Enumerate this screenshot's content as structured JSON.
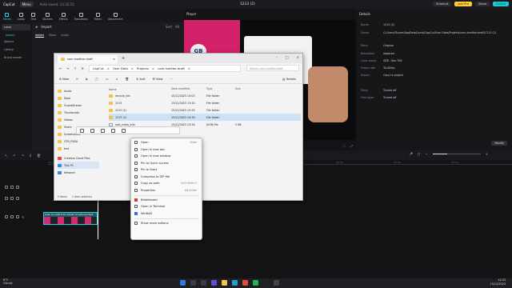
{
  "app": {
    "brand": "CapCut",
    "menu_label": "Menu",
    "autosave": "Auto saved: 13:32:53",
    "title": "1213 (2)",
    "shortcut_label": "Shortcut",
    "join_pro_label": "Join Pro",
    "share_label": "Share",
    "export_label": "Export"
  },
  "tools": [
    {
      "label": "Media",
      "active": true
    },
    {
      "label": "Audio"
    },
    {
      "label": "Text"
    },
    {
      "label": "Stickers"
    },
    {
      "label": "Effects"
    },
    {
      "label": "Transitions"
    },
    {
      "label": "Filters"
    },
    {
      "label": "Adjustment"
    }
  ],
  "left_sidebar": {
    "items": [
      "Local",
      "Import",
      "Spaces",
      "Library",
      "Brand assets"
    ]
  },
  "media": {
    "import_label": "Import",
    "sort_label": "Sort",
    "all_label": "All",
    "tabs": [
      "Added",
      "Video",
      "Audio"
    ]
  },
  "player": {
    "title": "Player",
    "logo_text": "GB"
  },
  "details": {
    "title": "Details",
    "rows": [
      {
        "k": "Name",
        "v": "1213 (2)"
      },
      {
        "k": "Saved",
        "v": "C:/Users/Tucker/AppData/Local/CapCut/User Data/Projects/com.lveditor.draft/1213 (2)"
      },
      {
        "k": "Ratio",
        "v": "Original"
      },
      {
        "k": "Resolution",
        "v": "Adapted"
      },
      {
        "k": "Color space",
        "v": "SDR - Rec.709"
      },
      {
        "k": "Frame rate",
        "v": "30.00fps"
      },
      {
        "k": "Import",
        "v": "Copy to project"
      },
      {
        "k": "Proxy",
        "v": "Turned off"
      },
      {
        "k": "Free layer",
        "v": "Turned off"
      }
    ],
    "modify_label": "Modify"
  },
  "timeline": {
    "ticks": [
      "00:00",
      "00:10",
      "00:20",
      "00:30",
      "00:40",
      "00:50",
      "01:00",
      "01:10"
    ],
    "clip_label": "scan qr code from photo on iphone.mp4"
  },
  "explorer": {
    "tab_title": "com.lveditor.draft",
    "crumbs": [
      "CapCut",
      ">",
      "User Data",
      ">",
      "Projects",
      ">",
      "com.lveditor.draft",
      ">"
    ],
    "search_placeholder": "Search com.lveditor.draft",
    "cmd": [
      "New",
      "Sort",
      "View",
      "Details"
    ],
    "nav": [
      "Audio",
      "Dipsi",
      "GuardStream",
      "Thumbnails",
      "Videos",
      "Share",
      "Screenshots",
      "GTR_FNSA",
      "test",
      "Creative Cloud Files",
      "This PC",
      "Network"
    ],
    "headers": {
      "name": "Name",
      "date": "Date modified",
      "type": "Type",
      "size": "Size"
    },
    "rows": [
      {
        "name": "recycle_bin",
        "date": "15/12/2023 13:03",
        "type": "File folder",
        "size": ""
      },
      {
        "name": "1213",
        "date": "15/12/2023 13:10",
        "type": "File folder",
        "size": ""
      },
      {
        "name": "1213 (1)",
        "date": "15/12/2023 13:29",
        "type": "File folder",
        "size": ""
      },
      {
        "name": "1213 (2)",
        "date": "15/12/2023 13:30",
        "type": "File folder",
        "size": ""
      },
      {
        "name": "root_meta_info",
        "date": "15/12/2023 13:30",
        "type": "JSON File",
        "size": "2 KB"
      }
    ],
    "status_items": "5 items",
    "status_selected": "1 item selected"
  },
  "context_menu": {
    "items": [
      {
        "label": "Open",
        "shortcut": "Enter"
      },
      {
        "label": "Open in new tab",
        "shortcut": ""
      },
      {
        "label": "Open in new window",
        "shortcut": ""
      },
      {
        "label": "Pin to Quick access",
        "shortcut": ""
      },
      {
        "label": "Pin to Start",
        "shortcut": ""
      },
      {
        "label": "Compress to ZIP file",
        "shortcut": ""
      },
      {
        "label": "Copy as path",
        "shortcut": "Ctrl+Shift+C"
      },
      {
        "label": "Properties",
        "shortcut": "Alt+Enter"
      },
      {
        "label": "Bitdefender",
        "shortcut": ""
      },
      {
        "label": "Open in Terminal",
        "shortcut": ""
      },
      {
        "label": "WinRAR",
        "shortcut": ""
      },
      {
        "label": "Show more options",
        "shortcut": ""
      }
    ]
  },
  "taskbar": {
    "temp": "8°C",
    "weather": "Cloudy",
    "time": "13:33",
    "date": "15/12/2023"
  }
}
